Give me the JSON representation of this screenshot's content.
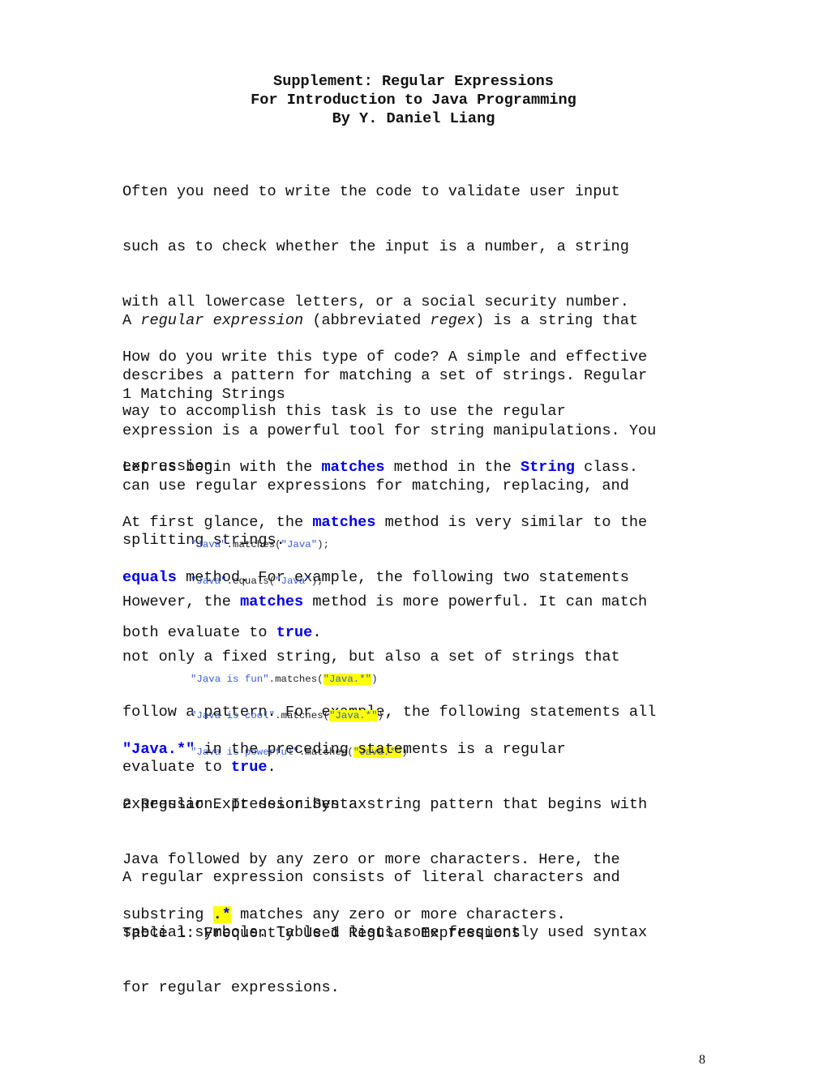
{
  "header": {
    "title_line1": "Supplement: Regular Expressions",
    "title_line2": "For Introduction to Java Programming",
    "author": "By Y. Daniel Liang"
  },
  "intro": {
    "lines": [
      "Often you need to write the code to validate user input",
      "such as to check whether the input is a number, a string",
      "with all lowercase letters, or a social security number.",
      "How do you write this type of code? A simple and effective",
      "way to accomplish this task is to use the regular",
      "expression."
    ]
  },
  "definition": {
    "prefix": "A ",
    "term": "regular expression",
    "mid": " (abbreviated ",
    "abbr": "regex",
    "suffix": ") is a string that",
    "lines": [
      "describes a pattern for matching a set of strings. Regular",
      "expression is a powerful tool for string manipulations. You",
      "can use regular expressions for matching, replacing, and",
      "splitting strings."
    ]
  },
  "section1": {
    "heading": "1 Matching Strings"
  },
  "para_matches": {
    "l1_a": "Let us begin with the ",
    "l1_kw1": "matches",
    "l1_b": " method in the ",
    "l1_kw2": "String",
    "l1_c": " class.",
    "l2_a": "At first glance, the ",
    "l2_kw": "matches",
    "l2_b": " method is very similar to the",
    "l3_kw": "equals",
    "l3_b": " method. For example, the following two statements",
    "l4_a": "both evaluate to ",
    "l4_kw": "true",
    "l4_b": "."
  },
  "code1": [
    {
      "str": "\"Java\"",
      "method": ".matches(",
      "arg": "\"Java\"",
      "end": ");"
    },
    {
      "str": "\"Java\"",
      "method": ".equals(",
      "arg": "\"Java\"",
      "end": ");"
    }
  ],
  "para_powerful": {
    "l1_a": "However, the ",
    "l1_kw": "matches",
    "l1_b": " method is more powerful. It can match",
    "l2": "not only a fixed string, but also a set of strings that",
    "l3": "follow a pattern. For example, the following statements all",
    "l4_a": "evaluate to ",
    "l4_kw": "true",
    "l4_b": "."
  },
  "code2": [
    {
      "str": "\"Java is fun\"",
      "method": ".matches(",
      "arg": "\"Java.*\"",
      "end": ")"
    },
    {
      "str": "\"Java is cool\"",
      "method": ".matches(",
      "arg": "\"Java.*\"",
      "end": ")"
    },
    {
      "str": "\"Java is powerful\"",
      "method": ".matches(",
      "arg": "\"Java.*\"",
      "end": ")"
    }
  ],
  "para_regex": {
    "l1_kw": "\"Java.*\"",
    "l1_b": " in the preceding statements is a regular",
    "l2": "expression. It describes a string pattern that begins with",
    "l3": "Java followed by any zero or more characters. Here, the",
    "l4_a": "substring ",
    "l4_kw": ".*",
    "l4_b": " matches any zero or more characters."
  },
  "section2": {
    "heading": "2 Regular Expression Syntax"
  },
  "para_syntax": {
    "lines": [
      "A regular expression consists of literal characters and",
      "special symbols. Table 1 lists some frequently used syntax",
      "for regular expressions."
    ]
  },
  "table_caption": "Table 1: Frequently Used Regular Expressions",
  "footer": {
    "page_number": "8"
  }
}
